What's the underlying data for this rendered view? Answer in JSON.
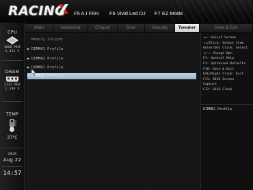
{
  "header": {
    "logo_text": "RACING",
    "buttons": [
      {
        "label": "F5 A.I FAN"
      },
      {
        "label": "F6 Vivid Led DJ"
      },
      {
        "label": "F7 EZ Mode"
      }
    ]
  },
  "sidebar": {
    "cpu": {
      "title": "CPU",
      "value1": "3600 MHZ",
      "value2": "1.451 V"
    },
    "dram": {
      "title": "DRAM",
      "value1": "2133 MHZ",
      "value2": "1.199 V"
    },
    "temp": {
      "title": "TEMP",
      "value": "37℃"
    },
    "date": {
      "year": "2020",
      "day": "Aug 22"
    },
    "time": "14:57"
  },
  "tabs": [
    {
      "label": "Main"
    },
    {
      "label": "Advanced"
    },
    {
      "label": "Chipset"
    },
    {
      "label": "Boot"
    },
    {
      "label": "Security"
    },
    {
      "label": "Tweaker"
    },
    {
      "label": "Save & Exit"
    }
  ],
  "active_tab": "Tweaker",
  "main": {
    "heading": "Memory Insight",
    "items": [
      {
        "label": "DIMMA1 Profile"
      },
      {
        "label": "DIMMA2 Profile"
      },
      {
        "label": "DIMMB1 Profile"
      },
      {
        "label": "DIMMB2 Profile"
      }
    ],
    "selected_item": "DIMMB2 Profile"
  },
  "help": {
    "lines": [
      "→←: Select Screen",
      "↑↓/Click: Select Item",
      "Enter/Dbl Click: Select",
      "+/-: Change Opt.",
      "F1: General Help",
      "F3: Optimized Defaults",
      "F10: Save & Exit",
      "ESC/Right Click: Exit",
      "F11: BIOS Screen",
      "Capture",
      "F12: BIOS Flash"
    ],
    "description": "DIMMB2 Profile"
  }
}
